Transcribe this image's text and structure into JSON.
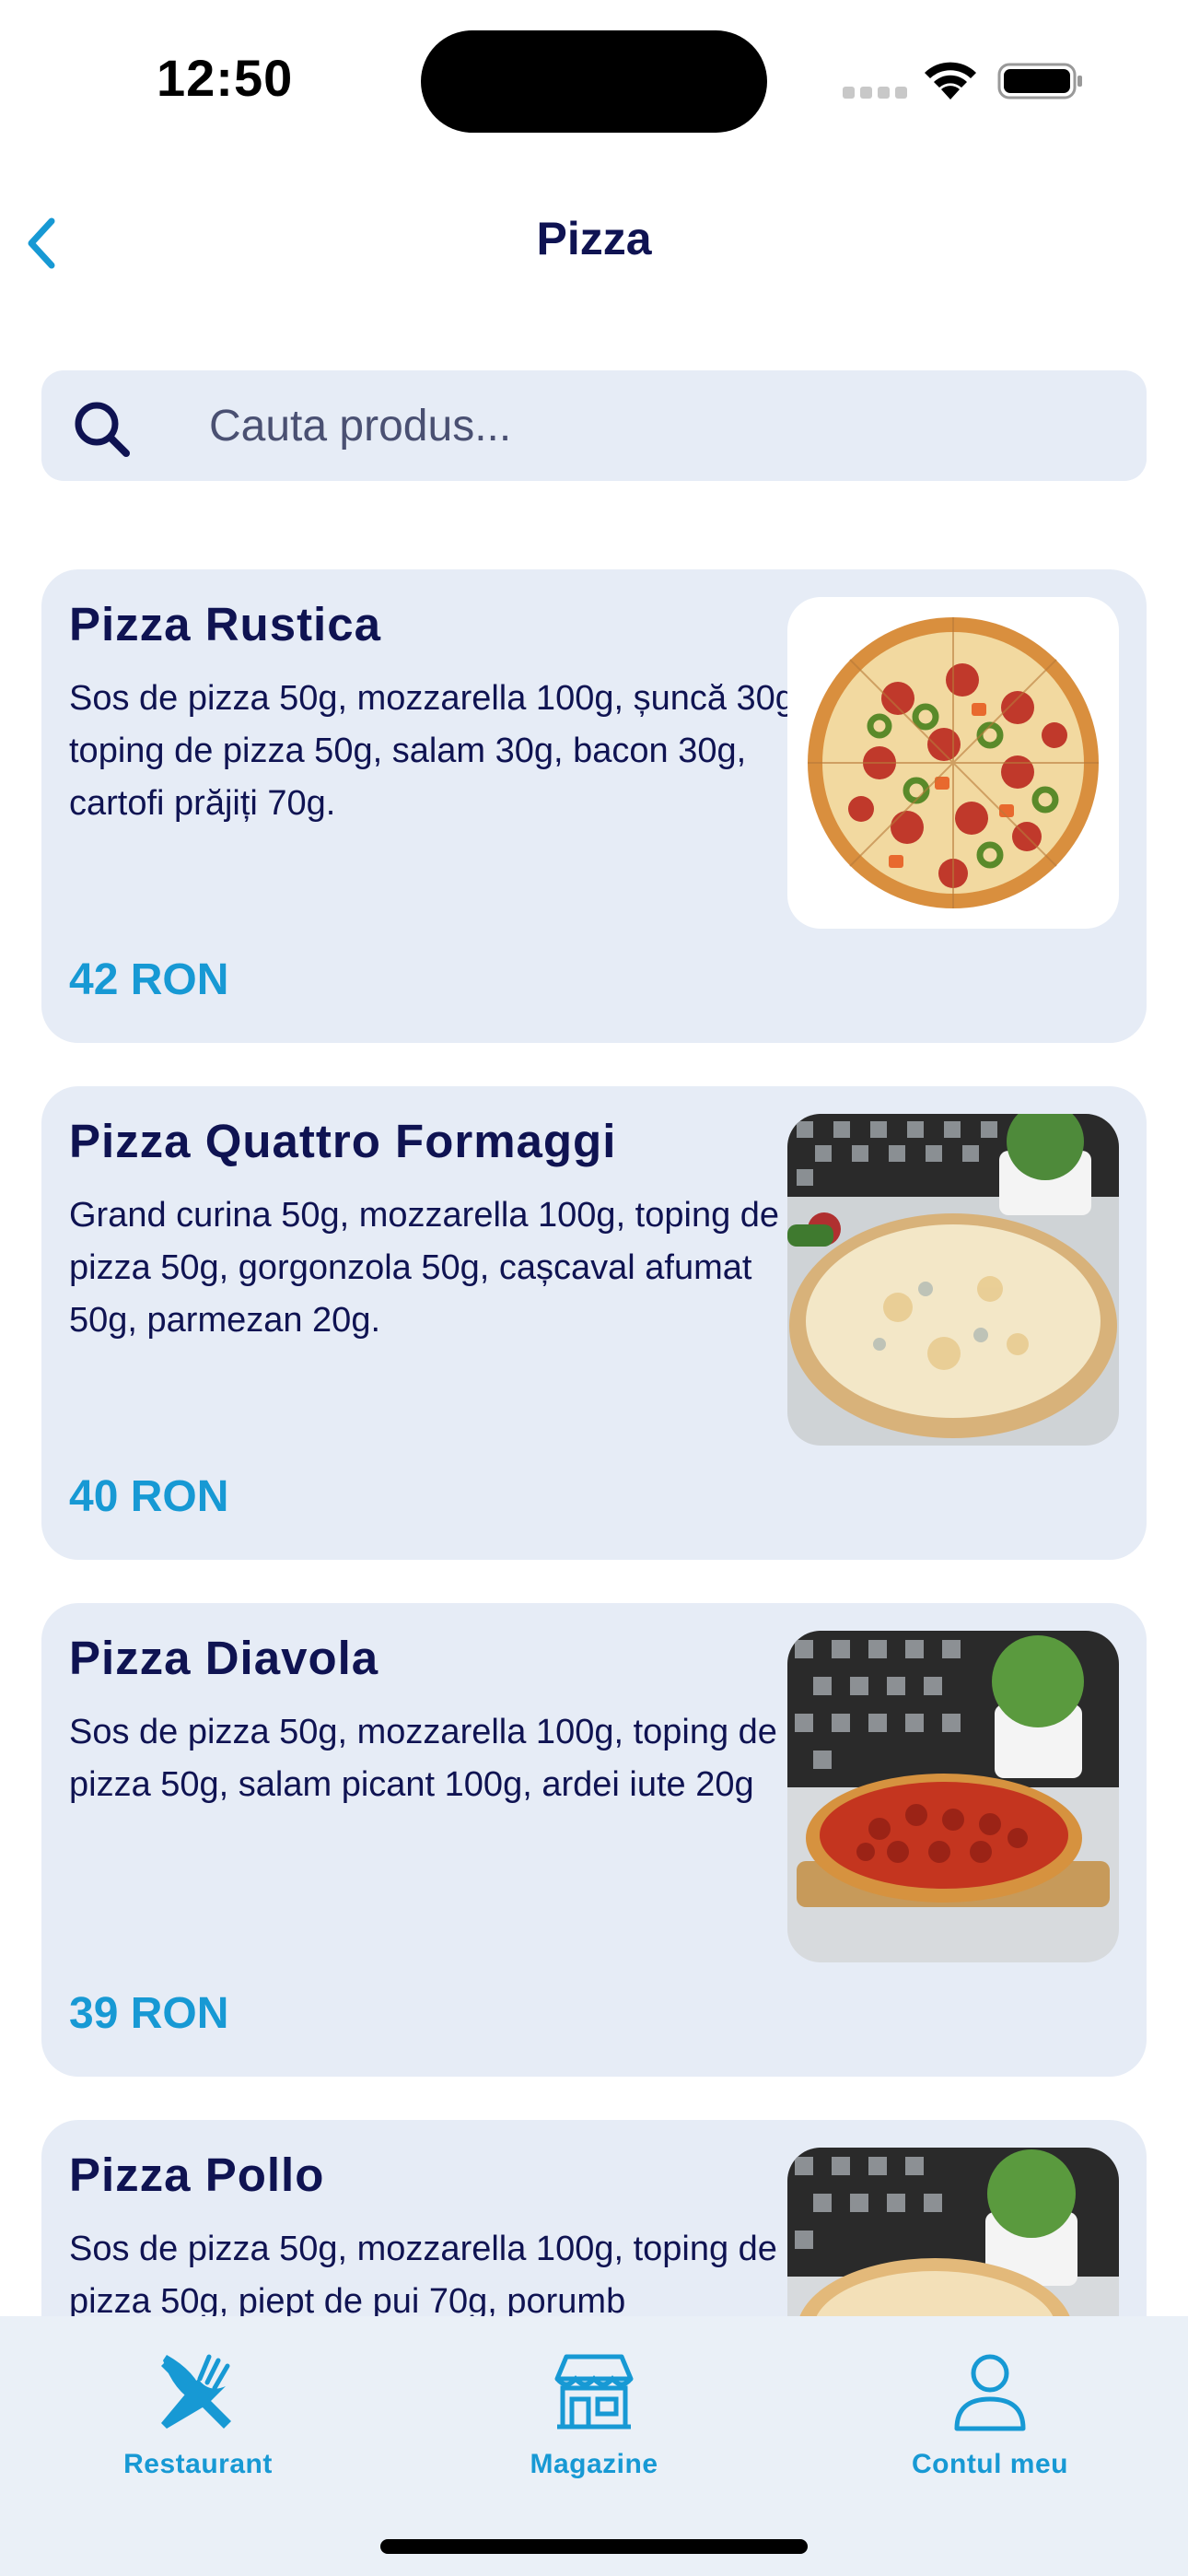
{
  "status_bar": {
    "time": "12:50"
  },
  "header": {
    "title": "Pizza",
    "back_icon": "chevron-left-icon"
  },
  "search": {
    "placeholder": "Cauta produs...",
    "value": "",
    "icon": "search-icon"
  },
  "products": [
    {
      "name": "Pizza Rustica",
      "description": "Sos de pizza 50g, mozzarella 100g, șuncă 30g, toping de pizza 50g, salam 30g, bacon 30g, cartofi prăjiți 70g.",
      "price": "42 RON"
    },
    {
      "name": "Pizza Quattro Formaggi",
      "description": "Grand curina 50g, mozzarella 100g, toping de pizza 50g, gorgonzola 50g, cașcaval afumat 50g, parmezan 20g.",
      "price": "40 RON"
    },
    {
      "name": "Pizza Diavola",
      "description": "Sos de pizza 50g, mozzarella 100g, toping de pizza 50g, salam picant 100g, ardei iute 20g",
      "price": "39 RON"
    },
    {
      "name": "Pizza Pollo",
      "description": "Sos de pizza 50g, mozzarella 100g, toping de pizza 50g, piept de pui 70g, porumb",
      "price": ""
    }
  ],
  "tabbar": {
    "tabs": [
      {
        "label": "Restaurant",
        "icon": "fork-knife-icon"
      },
      {
        "label": "Magazine",
        "icon": "store-icon"
      },
      {
        "label": "Contul meu",
        "icon": "user-icon"
      }
    ]
  },
  "colors": {
    "accent": "#1799d4",
    "text": "#0f1352",
    "card": "#e6ecf6"
  }
}
